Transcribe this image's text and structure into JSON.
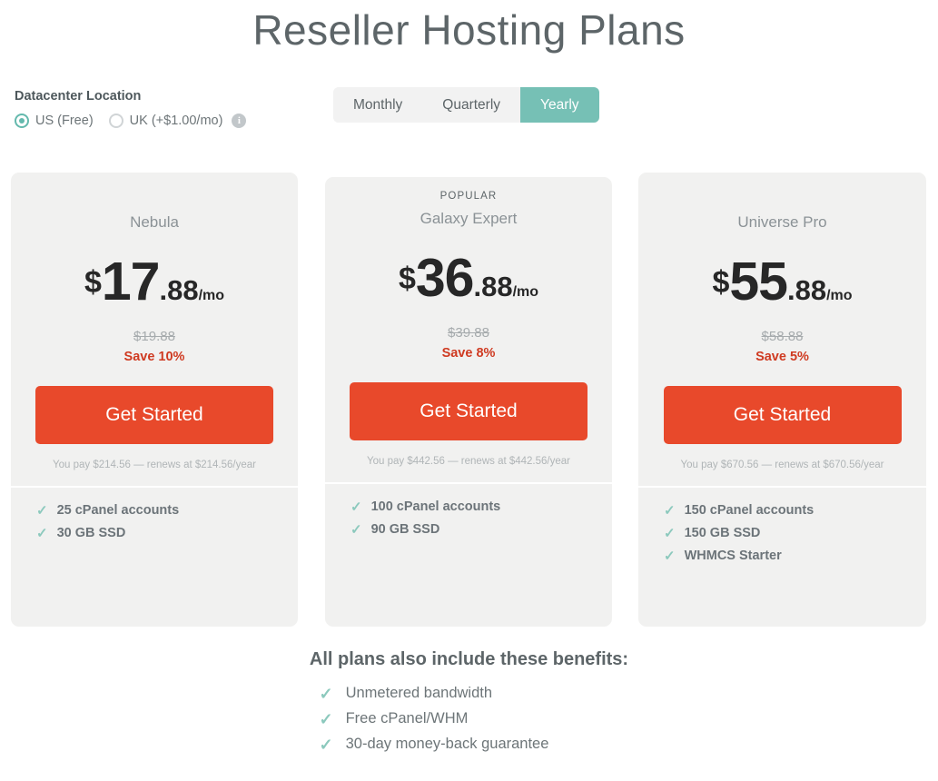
{
  "page": {
    "title": "Reseller Hosting Plans"
  },
  "datacenter": {
    "label": "Datacenter Location",
    "options": [
      {
        "label": "US (Free)",
        "selected": true
      },
      {
        "label": "UK (+$1.00/mo)",
        "selected": false
      }
    ],
    "info_icon": "info-icon",
    "info_glyph": "i"
  },
  "billing_cycle": {
    "tabs": [
      {
        "label": "Monthly",
        "active": false
      },
      {
        "label": "Quarterly",
        "active": false
      },
      {
        "label": "Yearly",
        "active": true
      }
    ]
  },
  "plans": [
    {
      "badge": "",
      "name": "Nebula",
      "currency": "$",
      "price_int": "17",
      "price_dec": ".88",
      "price_per": "/mo",
      "old_price": "$19.88",
      "save": "Save 10%",
      "cta": "Get Started",
      "renew_note": "You pay $214.56 — renews at $214.56/year",
      "features": [
        "25 cPanel accounts",
        "30 GB SSD"
      ]
    },
    {
      "badge": "POPULAR",
      "name": "Galaxy Expert",
      "currency": "$",
      "price_int": "36",
      "price_dec": ".88",
      "price_per": "/mo",
      "old_price": "$39.88",
      "save": "Save 8%",
      "cta": "Get Started",
      "renew_note": "You pay $442.56 — renews at $442.56/year",
      "features": [
        "100 cPanel accounts",
        "90 GB SSD"
      ]
    },
    {
      "badge": "",
      "name": "Universe Pro",
      "currency": "$",
      "price_int": "55",
      "price_dec": ".88",
      "price_per": "/mo",
      "old_price": "$58.88",
      "save": "Save 5%",
      "cta": "Get Started",
      "renew_note": "You pay $670.56 — renews at $670.56/year",
      "features": [
        "150 cPanel accounts",
        "150 GB SSD",
        "WHMCS Starter"
      ]
    }
  ],
  "benefits": {
    "title": "All plans also include these benefits:",
    "items": [
      "Unmetered bandwidth",
      "Free cPanel/WHM",
      "30-day money-back guarantee"
    ],
    "tick_glyph": "✓"
  },
  "colors": {
    "accent_teal": "#76c0b5",
    "cta_orange": "#e8492b",
    "save_red": "#cf3a21",
    "card_bg": "#f1f1f0",
    "tick_teal": "#8cc9bd"
  }
}
